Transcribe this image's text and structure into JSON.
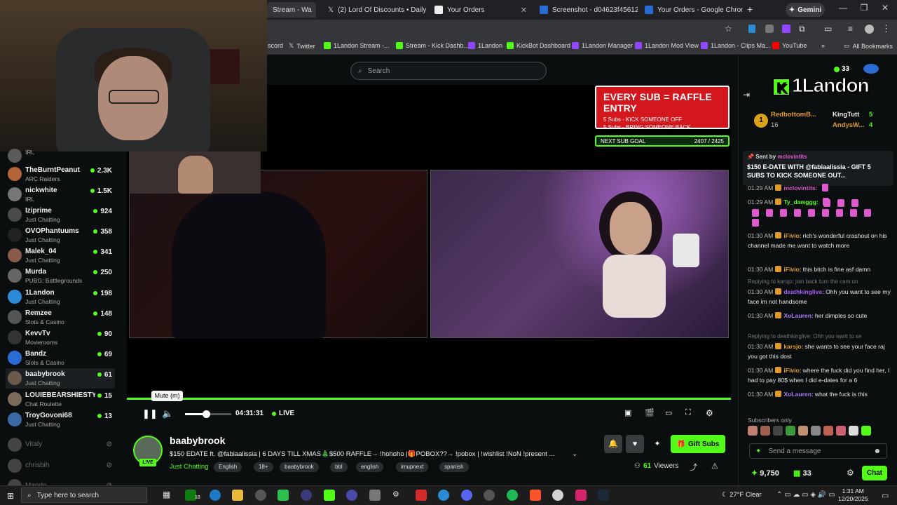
{
  "browser": {
    "tabs": [
      {
        "label": "Stream - Wa",
        "color": "#53fc18"
      },
      {
        "label": "(2) Lord Of Discounts • Daily",
        "color": "#ffffff"
      },
      {
        "label": "Your Orders",
        "color": "#111111"
      },
      {
        "label": "Screenshot - d04623f45612b",
        "color": "#2b6cd4"
      },
      {
        "label": "Your Orders - Google Chrom",
        "color": "#2b6cd4"
      }
    ],
    "gemini_label": "Gemini",
    "bookmarks": [
      {
        "label": "scord",
        "color": "#5865f2"
      },
      {
        "label": "Twitter",
        "color": "#ffffff"
      },
      {
        "label": "1Landon Stream -...",
        "color": "#53fc18"
      },
      {
        "label": "Stream - Kick Dashb...",
        "color": "#53fc18"
      },
      {
        "label": "1Landon",
        "color": "#9146ff"
      },
      {
        "label": "KickBot Dashboard",
        "color": "#53fc18"
      },
      {
        "label": "1Landon Manager",
        "color": "#9146ff"
      },
      {
        "label": "1Landon Mod View",
        "color": "#9146ff"
      },
      {
        "label": "1Landon - Clips Ma...",
        "color": "#9146ff"
      },
      {
        "label": "YouTube",
        "color": "#ff0000"
      }
    ],
    "all_bookmarks": "All Bookmarks"
  },
  "search": {
    "placeholder": "Search"
  },
  "sidebar": {
    "channels": [
      {
        "name": "",
        "category": "IRL",
        "viewers": "",
        "color": "#5a5a5a"
      },
      {
        "name": "TheBurntPeanut",
        "category": "ARC Raiders",
        "viewers": "2.3K",
        "color": "#b5643a"
      },
      {
        "name": "nickwhite",
        "category": "IRL",
        "viewers": "1.5K",
        "color": "#777777"
      },
      {
        "name": "Iziprime",
        "category": "Just Chatting",
        "viewers": "924",
        "color": "#4a4a4a"
      },
      {
        "name": "OVOPhantuums",
        "category": "Just Chatting",
        "viewers": "358",
        "color": "#222222"
      },
      {
        "name": "Malek_04",
        "category": "Just Chatting",
        "viewers": "341",
        "color": "#8a5a4a"
      },
      {
        "name": "Murda",
        "category": "PUBG: Battlegrounds",
        "viewers": "250",
        "color": "#666666"
      },
      {
        "name": "1Landon",
        "category": "Just Chatting",
        "viewers": "198",
        "color": "#2b8ad4"
      },
      {
        "name": "Remzee",
        "category": "Slots & Casino",
        "viewers": "148",
        "color": "#555555"
      },
      {
        "name": "KevvTv",
        "category": "Movierooms",
        "viewers": "90",
        "color": "#333333"
      },
      {
        "name": "Bandz",
        "category": "Slots & Casino",
        "viewers": "69",
        "color": "#2b6cd4"
      },
      {
        "name": "baabybrook",
        "category": "Just Chatting",
        "viewers": "61",
        "color": "#6a5a4a"
      },
      {
        "name": "LOUIEBEARSHIESTY4",
        "category": "Chat Roulette",
        "viewers": "15",
        "color": "#7a6a5a"
      },
      {
        "name": "TroyGovoni68",
        "category": "Just Chatting",
        "viewers": "13",
        "color": "#3a6aa4"
      },
      {
        "name": "Vitaly",
        "category": "",
        "viewers": "",
        "color": "#444444",
        "offline": true
      },
      {
        "name": "chrisbih",
        "category": "",
        "viewers": "",
        "color": "#444444",
        "offline": true
      },
      {
        "name": "Mando",
        "category": "",
        "viewers": "",
        "color": "#444444",
        "offline": true
      }
    ]
  },
  "overlay": {
    "raffle_title": "EVERY SUB = RAFFLE ENTRY",
    "raffle_line1": "5 Subs - KICK SOMEONE OFF",
    "raffle_line2": "5 Subs - BRING SOMEONE BACK",
    "subgoal_label": "NEXT SUB GOAL",
    "subgoal_value": "2407 / 2425"
  },
  "player": {
    "tooltip": "Mute (m)",
    "time": "04:31:31",
    "live": "LIVE",
    "volume_fraction": 0.45,
    "progress_fraction": 1.0
  },
  "stream": {
    "live_badge": "LIVE",
    "name": "baabybrook",
    "title": "$150 EDATE ft. @fabiaalissia | 6 DAYS TILL XMAS🎄$500 RAFFLE→ !hohoho |🎁POBOX??→ !pobox | !wishlist !NoN !present ...",
    "category": "Just Chatting",
    "tags": [
      "English",
      "18+",
      "baabybrook",
      "bbl",
      "english",
      "imupnext",
      "spanish"
    ],
    "gift_label": "Gift Subs",
    "viewers_count": "61",
    "viewers_label": "Viewers"
  },
  "chat": {
    "viewer_count": "33",
    "logo": "1Landon",
    "logo_k": "K",
    "leaders": [
      {
        "rank": "1",
        "name": "RedbottomB...",
        "count": "16"
      },
      {
        "name": "KingTutt",
        "count": "5"
      },
      {
        "name": "AndysW...",
        "count": "4"
      }
    ],
    "pinned_by_label": "Sent by",
    "pinned_by_user": "mclovintits",
    "pinned_text": "$150 E-DATE WITH @fabiaalissia - GIFT 5 SUBS TO KICK SOMEONE OUT...",
    "messages": [
      {
        "time": "01:29 AM",
        "user": "mclovintits:",
        "color": "#e05acf",
        "text": ""
      },
      {
        "time": "01:29 AM",
        "user": "Ty_dawggg:",
        "color": "#53fc18",
        "text": ""
      },
      {
        "time": "01:30 AM",
        "user": "iFivio:",
        "color": "#e09a2a",
        "text": "rich's wonderful crashout on his channel made me want to watch more"
      },
      {
        "time": "01:30 AM",
        "user": "iFivio:",
        "color": "#e09a2a",
        "text": "this bitch is fine asf damn"
      },
      {
        "reply": "Replying to karsjo: join back turn the cam on",
        "time": "01:30 AM",
        "user": "deathkinglive:",
        "color": "#b05aff",
        "text": "Ohh you want to see my face im not handsome"
      },
      {
        "time": "01:30 AM",
        "user": "XoLauren:",
        "color": "#a97aff",
        "text": "her dimples so cute"
      },
      {
        "reply": "Replying to deathkinglive: Ohh you want to se",
        "time": "01:30 AM",
        "user": "karsjo:",
        "color": "#e09a2a",
        "text": "she wants to see your face raj you got this dost"
      },
      {
        "time": "01:30 AM",
        "user": "iFivio:",
        "color": "#e09a2a",
        "text": "where the fuck did you find her, I had to pay 80$ when I did e-dates for a 6"
      },
      {
        "time": "01:30 AM",
        "user": "XoLauren:",
        "color": "#a97aff",
        "text": "what the fuck is this"
      }
    ],
    "subscribers_only": "Subscribers only",
    "send_placeholder": "Send a message",
    "points": "9,750",
    "users": "33",
    "chat_button": "Chat"
  },
  "taskbar": {
    "search_placeholder": "Type here to search",
    "weather": "27°F Clear",
    "time": "1:31 AM",
    "date": "12/20/2025",
    "badge": "18"
  }
}
